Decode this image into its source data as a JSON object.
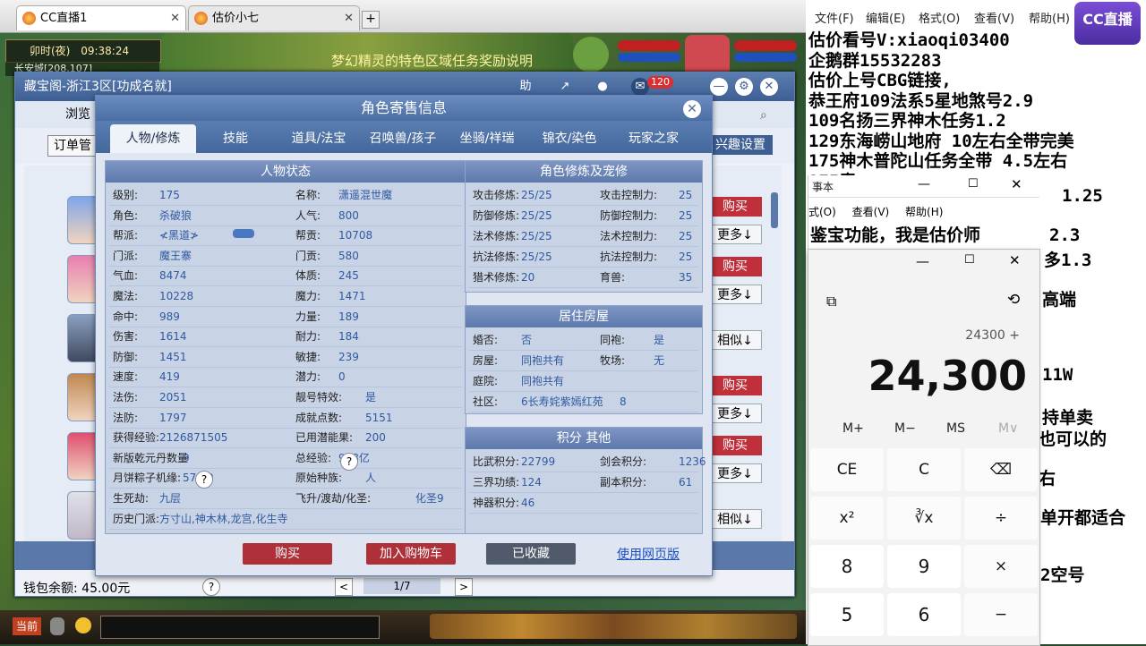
{
  "browser": {
    "tabs": [
      {
        "label": "CC直播1"
      },
      {
        "label": "估价小七"
      }
    ],
    "new_tab": "+"
  },
  "game": {
    "time_label": "卯时(夜)",
    "clock": "09:38:24",
    "location": "长安城[208,107]",
    "banner_text": "梦幻精灵的特色区域任务奖励说明"
  },
  "cbg": {
    "title": "藏宝阁-浙江3区[功成名就]",
    "badge_count": "120",
    "nav_first": "浏览",
    "order_btn": "订单管",
    "interest_btn": "兴趣设置",
    "list_buttons": [
      "购买",
      "更多↓",
      "购买",
      "更多↓",
      "相似↓",
      "购买",
      "更多↓",
      "购买",
      "更多↓",
      "相似↓"
    ],
    "wallet": "钱包余额: 45.00元",
    "pager": {
      "prev": "<",
      "page": "1/7",
      "next": ">"
    }
  },
  "dialog": {
    "title": "角色寄售信息",
    "close": "✕",
    "tabs": [
      "人物/修炼",
      "技能",
      "道具/法宝",
      "召唤兽/孩子",
      "坐骑/祥瑞",
      "锦衣/染色",
      "玩家之家"
    ],
    "status_title": "人物状态",
    "status_left": [
      {
        "k": "级别:",
        "v": "175"
      },
      {
        "k": "角色:",
        "v": "杀破狼"
      },
      {
        "k": "帮派:",
        "v": "≮黑道≯"
      },
      {
        "k": "门派:",
        "v": "魔王寨"
      },
      {
        "k": "气血:",
        "v": "8474"
      },
      {
        "k": "魔法:",
        "v": "10228"
      },
      {
        "k": "命中:",
        "v": "989"
      },
      {
        "k": "伤害:",
        "v": "1614"
      },
      {
        "k": "防御:",
        "v": "1451"
      },
      {
        "k": "速度:",
        "v": "419"
      },
      {
        "k": "法伤:",
        "v": "2051"
      },
      {
        "k": "法防:",
        "v": "1797"
      },
      {
        "k": "获得经验:",
        "v": "2126871505"
      },
      {
        "k": "新版乾元丹数量",
        "v": "9"
      },
      {
        "k": "月饼粽子机缘:",
        "v": "57/60"
      },
      {
        "k": "生死劫:",
        "v": "九层"
      },
      {
        "k": "历史门派:",
        "v": "方寸山,神木林,龙宫,化生寺"
      }
    ],
    "status_right": [
      {
        "k": "名称:",
        "v": "潇遥混世魔"
      },
      {
        "k": "人气:",
        "v": "800"
      },
      {
        "k": "帮贡:",
        "v": "10708"
      },
      {
        "k": "门贡:",
        "v": "580"
      },
      {
        "k": "体质:",
        "v": "245"
      },
      {
        "k": "魔力:",
        "v": "1471"
      },
      {
        "k": "力量:",
        "v": "189"
      },
      {
        "k": "耐力:",
        "v": "184"
      },
      {
        "k": "敏捷:",
        "v": "239"
      },
      {
        "k": "潜力:",
        "v": "0"
      },
      {
        "k": "靓号特效:",
        "v": "是"
      },
      {
        "k": "成就点数:",
        "v": "5151"
      },
      {
        "k": "已用潜能果:",
        "v": "200"
      },
      {
        "k": "总经验:",
        "v": "918亿"
      },
      {
        "k": "原始种族:",
        "v": "人"
      },
      {
        "k": "飞升/渡劫/化圣:",
        "v": "化圣9"
      }
    ],
    "cult_title": "角色修炼及宠修",
    "cult": [
      {
        "k": "攻击修炼:",
        "v": "25/25",
        "k2": "攻击控制力:",
        "v2": "25"
      },
      {
        "k": "防御修炼:",
        "v": "25/25",
        "k2": "防御控制力:",
        "v2": "25"
      },
      {
        "k": "法术修炼:",
        "v": "25/25",
        "k2": "法术控制力:",
        "v2": "25"
      },
      {
        "k": "抗法修炼:",
        "v": "25/25",
        "k2": "抗法控制力:",
        "v2": "25"
      },
      {
        "k": "猎术修炼:",
        "v": "20",
        "k2": "育兽:",
        "v2": "35"
      }
    ],
    "house_title": "居住房屋",
    "house": [
      {
        "k": "婚否:",
        "v": "否",
        "k2": "同袍:",
        "v2": "是"
      },
      {
        "k": "房屋:",
        "v": "同袍共有",
        "k2": "牧场:",
        "v2": "无"
      },
      {
        "k": "庭院:",
        "v": "同袍共有",
        "k2": "",
        "v2": ""
      },
      {
        "k": "社区:",
        "v": "6长寿姹紫嫣红苑",
        "k2": "",
        "v2": "8"
      }
    ],
    "score_title": "积分 其他",
    "score": [
      {
        "k": "比武积分:",
        "v": "22799",
        "k2": "剑会积分:",
        "v2": "1236"
      },
      {
        "k": "三界功绩:",
        "v": "124",
        "k2": "副本积分:",
        "v2": "61"
      },
      {
        "k": "神器积分:",
        "v": "46",
        "k2": "",
        "v2": ""
      }
    ],
    "buttons": {
      "buy": "购买",
      "cart": "加入购物车",
      "fav": "已收藏",
      "web": "使用网页版"
    }
  },
  "notepad": {
    "menu": [
      "文件(F)",
      "编辑(E)",
      "格式(O)",
      "查看(V)",
      "帮助(H)"
    ],
    "lines": [
      "估价看号V:xiaoqi03400",
      "企鹅群15532283",
      "估价上号CBG链接,",
      "恭王府109法系5星地煞号2.9",
      "109名扬三界神木任务1.2",
      "129东海崂山地府 10左右全带完美",
      "175神木普陀山任务全带 4.5左右",
      "175青"
    ],
    "right_fragments": [
      "1.25",
      "2.3",
      "多1.3",
      "高端",
      "11W",
      "持单卖",
      "也可以的",
      "右",
      "单开都适合",
      "2空号"
    ]
  },
  "notepad2": {
    "title": "事本",
    "menu": [
      "式(O)",
      "查看(V)",
      "帮助(H)"
    ],
    "line": "鉴宝功能，我是估价师"
  },
  "calculator": {
    "history": "24300 +",
    "display": "24,300",
    "memory": [
      "M+",
      "M−",
      "MS",
      "M∨"
    ],
    "keys": [
      [
        "CE",
        "C",
        "⌫"
      ],
      [
        "x²",
        "∛x",
        "÷"
      ],
      [
        "8",
        "9",
        "×"
      ],
      [
        "5",
        "6",
        "−"
      ]
    ]
  },
  "cclogo": "CC直播",
  "colors": {
    "accent": "#4b6ea4",
    "buy": "#c0303a",
    "value_text": "#2f5aa0"
  }
}
